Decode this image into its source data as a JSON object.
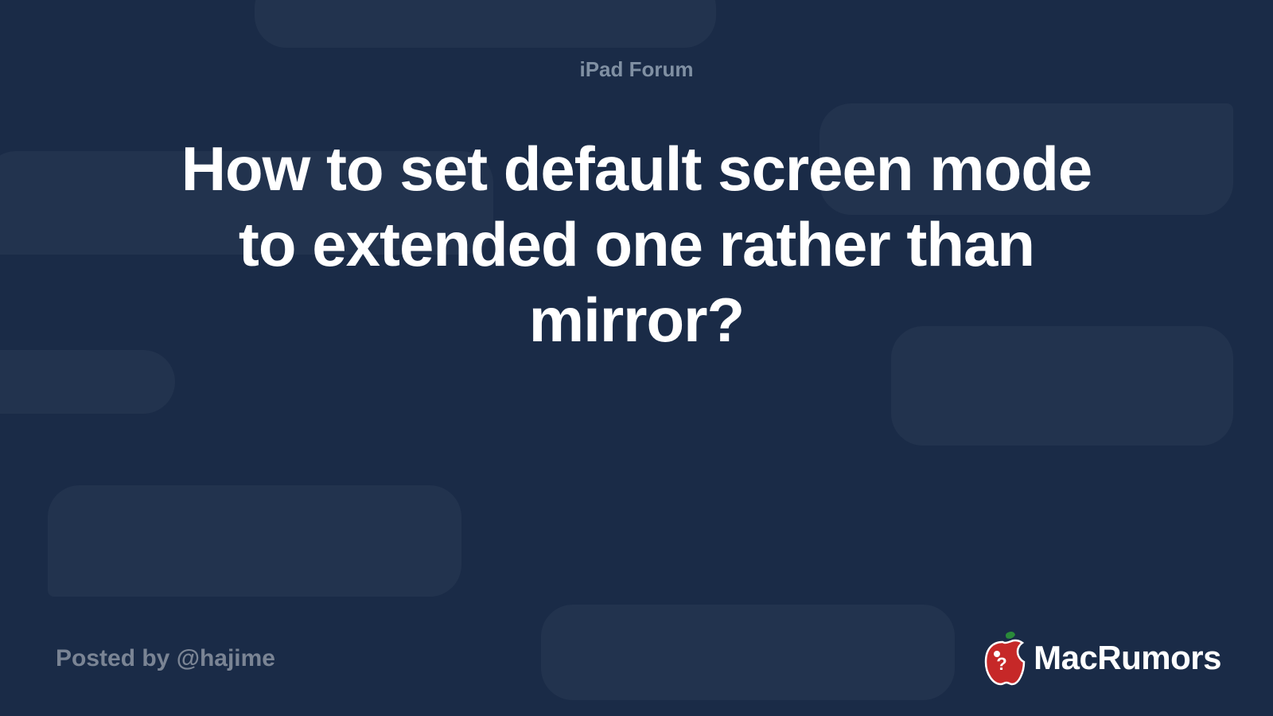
{
  "category": "iPad Forum",
  "title": "How to set default screen mode to extended one rather than mirror?",
  "posted_by": "Posted by @hajime",
  "brand": "MacRumors"
}
